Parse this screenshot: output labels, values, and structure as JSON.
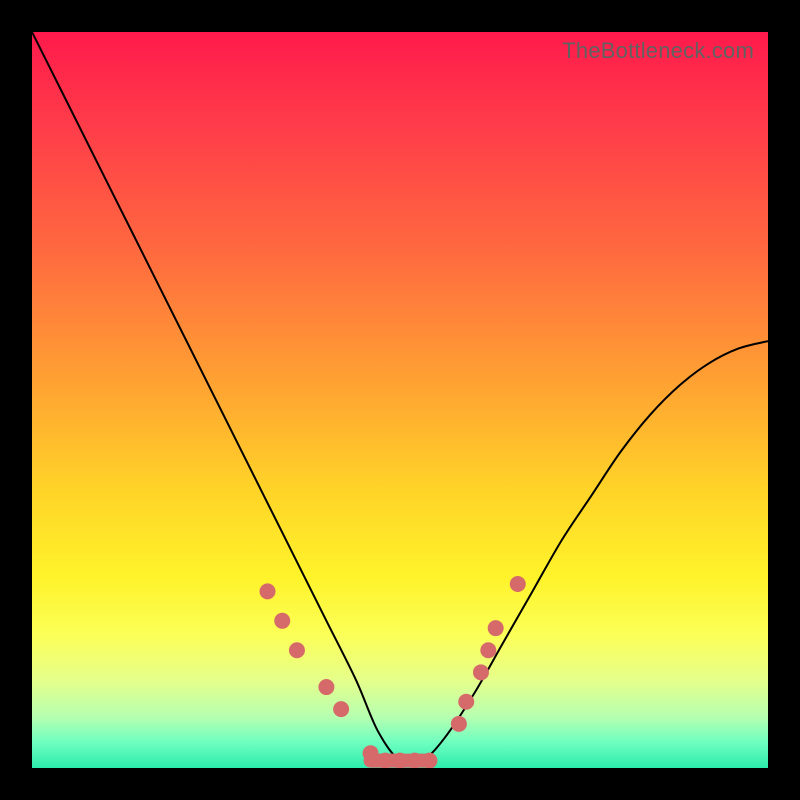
{
  "watermark": "TheBottleneck.com",
  "colors": {
    "frame": "#000000",
    "curve": "#000000",
    "marker": "#d66a6a",
    "gradient_stops": [
      {
        "offset": 0.0,
        "color": "#ff1a4b"
      },
      {
        "offset": 0.12,
        "color": "#ff3a4a"
      },
      {
        "offset": 0.3,
        "color": "#ff6a3f"
      },
      {
        "offset": 0.48,
        "color": "#ffa332"
      },
      {
        "offset": 0.62,
        "color": "#ffd328"
      },
      {
        "offset": 0.74,
        "color": "#fff32a"
      },
      {
        "offset": 0.82,
        "color": "#fbff58"
      },
      {
        "offset": 0.88,
        "color": "#e6ff8a"
      },
      {
        "offset": 0.93,
        "color": "#b7ffb0"
      },
      {
        "offset": 0.965,
        "color": "#6fffc0"
      },
      {
        "offset": 1.0,
        "color": "#2cecad"
      }
    ]
  },
  "chart_data": {
    "type": "line",
    "title": "",
    "xlabel": "",
    "ylabel": "",
    "xlim": [
      0,
      100
    ],
    "ylim": [
      0,
      100
    ],
    "series": [
      {
        "name": "bottleneck-curve",
        "x": [
          0,
          4,
          8,
          12,
          16,
          20,
          24,
          28,
          32,
          36,
          40,
          44,
          47,
          50,
          53,
          56,
          60,
          64,
          68,
          72,
          76,
          80,
          84,
          88,
          92,
          96,
          100
        ],
        "y": [
          100,
          92,
          84,
          76,
          68,
          60,
          52,
          44,
          36,
          28,
          20,
          12,
          5,
          1,
          1,
          4,
          10,
          17,
          24,
          31,
          37,
          43,
          48,
          52,
          55,
          57,
          58
        ]
      }
    ],
    "markers": {
      "name": "highlighted-points",
      "approx": true,
      "points": [
        {
          "x": 32,
          "y": 24
        },
        {
          "x": 34,
          "y": 20
        },
        {
          "x": 36,
          "y": 16
        },
        {
          "x": 40,
          "y": 11
        },
        {
          "x": 42,
          "y": 8
        },
        {
          "x": 46,
          "y": 2
        },
        {
          "x": 48,
          "y": 1
        },
        {
          "x": 50,
          "y": 1
        },
        {
          "x": 52,
          "y": 1
        },
        {
          "x": 54,
          "y": 1
        },
        {
          "x": 58,
          "y": 6
        },
        {
          "x": 59,
          "y": 9
        },
        {
          "x": 61,
          "y": 13
        },
        {
          "x": 62,
          "y": 16
        },
        {
          "x": 63,
          "y": 19
        },
        {
          "x": 66,
          "y": 25
        }
      ]
    },
    "trough_bar": {
      "x0": 46,
      "x1": 54,
      "y": 1
    }
  }
}
